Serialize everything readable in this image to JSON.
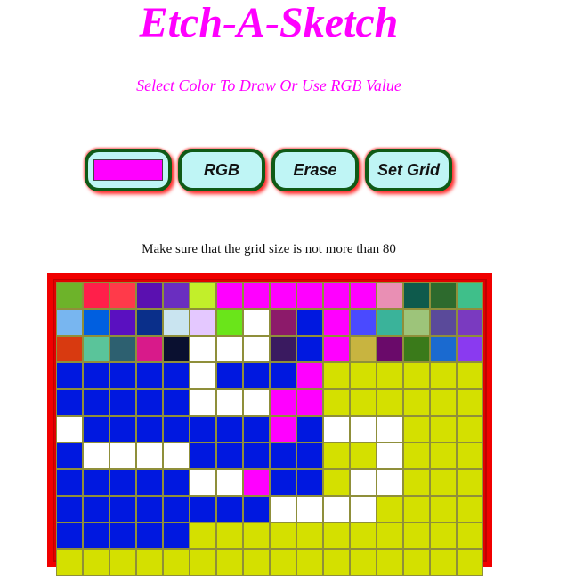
{
  "header": {
    "title": "Etch-A-Sketch",
    "subtitle": "Select Color To Draw Or Use RGB Value"
  },
  "controls": {
    "color_value": "#ff00ff",
    "rgb_label": "RGB",
    "erase_label": "Erase",
    "set_grid_label": "Set Grid"
  },
  "hint": "Make sure that the grid size is not more than 80",
  "colors": {
    "accent": "#ff00ff",
    "button_bg": "#bff5f5",
    "button_border": "#0f5a16",
    "board_frame": "#f00000"
  },
  "grid": {
    "palette": {
      "B": "#0018e0",
      "W": "#ffffff",
      "Y": "#d4e000",
      "M": "#ff00ff"
    },
    "rows": [
      [
        "#6db32a",
        "#ff1f4a",
        "#ff3a4a",
        "#5a10b0",
        "#6a2ec0",
        "#c2ef2a",
        "#ff00ff",
        "#ff00ff",
        "#ff00ff",
        "#ff00ff",
        "#ff00ff",
        "#ff00ff",
        "#e98fb4",
        "#0e5a4c",
        "#2d6a2d",
        "#3fbf8a"
      ],
      [
        "#78b6f0",
        "#005fe0",
        "#5a10c0",
        "#0a2f8a",
        "#c9e4f0",
        "#e4c8ff",
        "#6ae51a",
        "#ffffff",
        "#8c1a6a",
        "#0018e0",
        "#ff00ff",
        "#4a4aff",
        "#3ab39a",
        "#9dc47a",
        "#5a4a9a",
        "#7a3ac0"
      ],
      [
        "#d83a10",
        "#5ac49a",
        "#2d6070",
        "#d81a8a",
        "#0a1030",
        "#ffffff",
        "#ffffff",
        "#ffffff",
        "#3a1a60",
        "#0018e0",
        "#ff00ff",
        "#c8b440",
        "#6a0a6a",
        "#3a7a1a",
        "#1a6ad0",
        "#8a3af0"
      ],
      [
        "B",
        "B",
        "B",
        "B",
        "B",
        "W",
        "B",
        "B",
        "B",
        "M",
        "Y",
        "Y",
        "Y",
        "Y",
        "Y",
        "Y"
      ],
      [
        "B",
        "B",
        "B",
        "B",
        "B",
        "W",
        "W",
        "W",
        "M",
        "M",
        "Y",
        "Y",
        "Y",
        "Y",
        "Y",
        "Y"
      ],
      [
        "W",
        "B",
        "B",
        "B",
        "B",
        "B",
        "B",
        "B",
        "M",
        "B",
        "W",
        "W",
        "W",
        "Y",
        "Y",
        "Y"
      ],
      [
        "B",
        "W",
        "W",
        "W",
        "W",
        "B",
        "B",
        "B",
        "B",
        "B",
        "Y",
        "Y",
        "W",
        "Y",
        "Y",
        "Y"
      ],
      [
        "B",
        "B",
        "B",
        "B",
        "B",
        "W",
        "W",
        "M",
        "B",
        "B",
        "Y",
        "W",
        "W",
        "Y",
        "Y",
        "Y"
      ],
      [
        "B",
        "B",
        "B",
        "B",
        "B",
        "B",
        "B",
        "B",
        "W",
        "W",
        "W",
        "W",
        "Y",
        "Y",
        "Y",
        "Y"
      ],
      [
        "B",
        "B",
        "B",
        "B",
        "B",
        "Y",
        "Y",
        "Y",
        "Y",
        "Y",
        "Y",
        "Y",
        "Y",
        "Y",
        "Y",
        "Y"
      ],
      [
        "Y",
        "Y",
        "Y",
        "Y",
        "Y",
        "Y",
        "Y",
        "Y",
        "Y",
        "Y",
        "Y",
        "Y",
        "Y",
        "Y",
        "Y",
        "Y"
      ]
    ]
  }
}
